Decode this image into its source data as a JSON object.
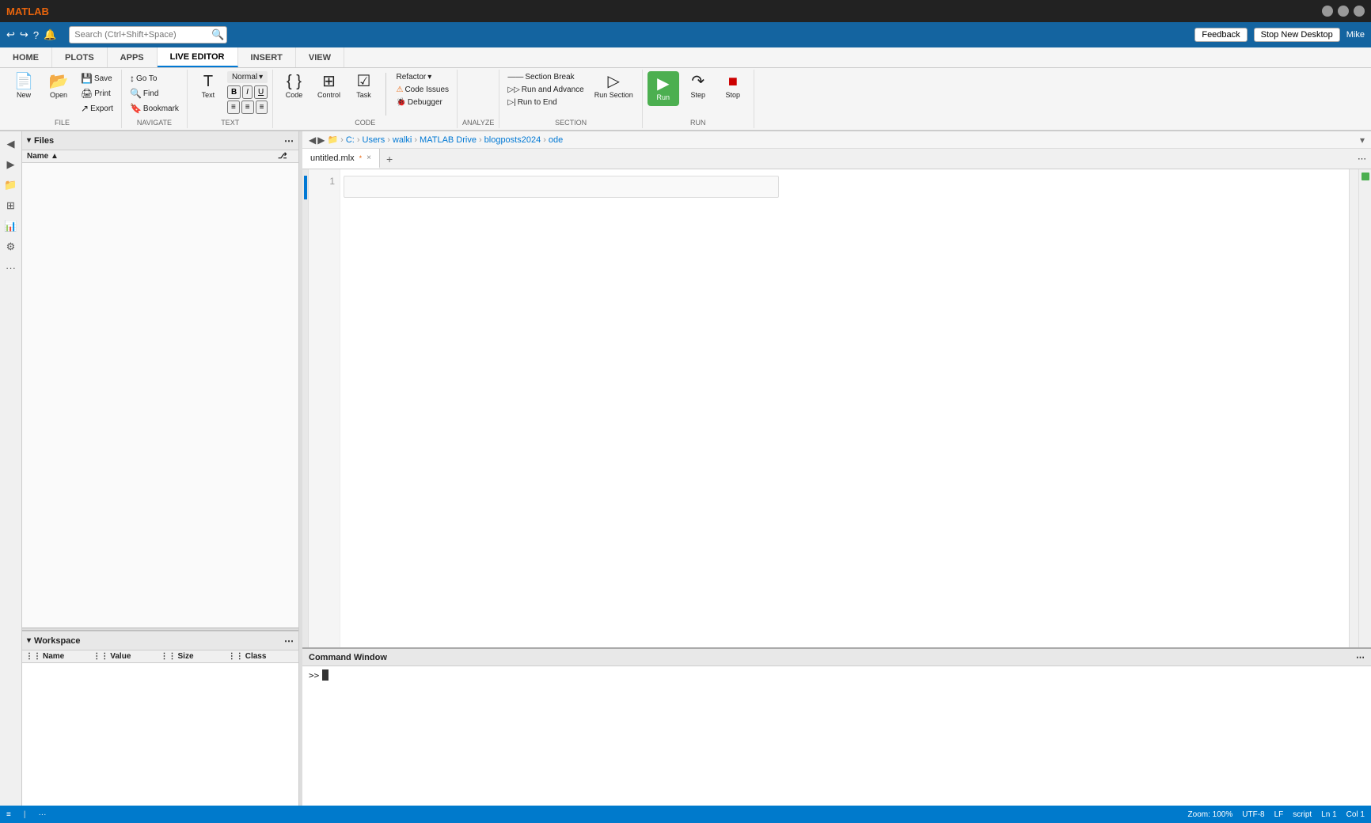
{
  "titlebar": {
    "logo": "MATLAB",
    "title": "MATLAB"
  },
  "menu_tabs": [
    {
      "id": "home",
      "label": "HOME"
    },
    {
      "id": "plots",
      "label": "PLOTS"
    },
    {
      "id": "apps",
      "label": "APPS"
    },
    {
      "id": "live_editor",
      "label": "LIVE EDITOR",
      "active": true
    },
    {
      "id": "insert",
      "label": "INSERT"
    },
    {
      "id": "view",
      "label": "VIEW"
    }
  ],
  "toolbar": {
    "feedback_label": "Feedback",
    "stop_new_desktop_label": "Stop New Desktop",
    "search_placeholder": "Search (Ctrl+Shift+Space)",
    "user_label": "Mike"
  },
  "file_group": {
    "label": "FILE",
    "new_label": "New",
    "open_label": "Open",
    "save_label": "Save",
    "print_label": "Print",
    "export_label": "Export"
  },
  "navigate_group": {
    "label": "NAVIGATE",
    "goto_label": "Go To",
    "find_label": "Find",
    "bookmark_label": "Bookmark"
  },
  "text_group": {
    "label": "TEXT",
    "text_label": "Text",
    "normal_label": "Normal"
  },
  "code_group": {
    "label": "CODE",
    "code_label": "Code",
    "control_label": "Control",
    "task_label": "Task",
    "refactor_label": "Refactor",
    "code_issues_label": "Code Issues",
    "debugger_label": "Debugger"
  },
  "analyze_group": {
    "label": "ANALYZE"
  },
  "section_group": {
    "label": "SECTION",
    "section_break_label": "Section Break",
    "run_section_label": "Run Section",
    "run_and_advance_label": "Run and Advance",
    "run_to_end_label": "Run to End"
  },
  "run_group": {
    "label": "RUN",
    "run_label": "Run",
    "step_label": "Step",
    "stop_label": "Stop"
  },
  "breadcrumb": {
    "back_label": "◀",
    "forward_label": "▶",
    "folder_icon": "📁",
    "path": [
      "C:",
      "Users",
      "walki",
      "MATLAB Drive",
      "blogposts2024",
      "ode"
    ]
  },
  "tab": {
    "filename": "untitled.mlx",
    "modified": true,
    "close_label": "×",
    "add_label": "+"
  },
  "editor": {
    "line_numbers": [
      "1"
    ],
    "code_placeholder": ""
  },
  "files_panel": {
    "title": "Files",
    "columns": [
      {
        "label": "Name",
        "sort": "asc"
      },
      {
        "label": ""
      },
      {
        "label": ""
      }
    ]
  },
  "workspace_panel": {
    "title": "Workspace",
    "columns": [
      {
        "label": "Name"
      },
      {
        "label": "Value"
      },
      {
        "label": "Size"
      },
      {
        "label": "Class"
      }
    ]
  },
  "command_window": {
    "title": "Command Window",
    "prompt": ">>",
    "cursor_text": ""
  },
  "status_bar": {
    "panels_label": "≡",
    "zoom_label": "Zoom: 100%",
    "encoding_label": "UTF-8",
    "line_ending_label": "LF",
    "mode_label": "script",
    "ln_label": "Ln 1",
    "col_label": "Col 1"
  }
}
